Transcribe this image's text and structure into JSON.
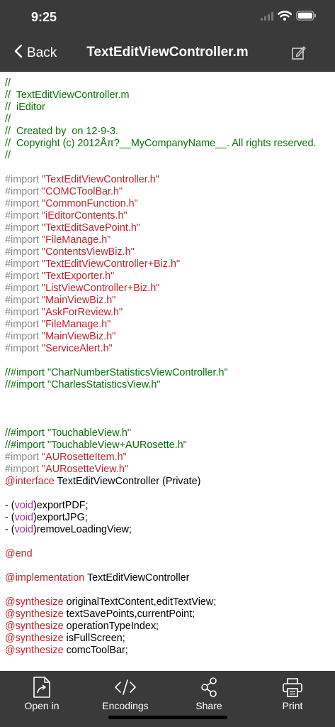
{
  "status": {
    "time": "9:25"
  },
  "nav": {
    "back_label": "Back",
    "title": "TextEditViewController.m"
  },
  "code_lines": [
    [
      [
        "c-comment",
        "//"
      ]
    ],
    [
      [
        "c-comment",
        "//  TextEditViewController.m"
      ]
    ],
    [
      [
        "c-comment",
        "//  iEditor"
      ]
    ],
    [
      [
        "c-comment",
        "//"
      ]
    ],
    [
      [
        "c-comment",
        "//  Created by  on 12-9-3."
      ]
    ],
    [
      [
        "c-comment",
        "//  Copyright (c) 2012Åπ?__MyCompanyName__. All rights reserved."
      ]
    ],
    [
      [
        "c-comment",
        "//"
      ]
    ],
    [],
    [
      [
        "c-pre",
        "#import "
      ],
      [
        "c-str",
        "\"TextEditViewController.h\""
      ]
    ],
    [
      [
        "c-pre",
        "#import "
      ],
      [
        "c-str",
        "\"COMCToolBar.h\""
      ]
    ],
    [
      [
        "c-pre",
        "#import "
      ],
      [
        "c-str",
        "\"CommonFunction.h\""
      ]
    ],
    [
      [
        "c-pre",
        "#import "
      ],
      [
        "c-str",
        "\"iEditorContents.h\""
      ]
    ],
    [
      [
        "c-pre",
        "#import "
      ],
      [
        "c-str",
        "\"TextEditSavePoint.h\""
      ]
    ],
    [
      [
        "c-pre",
        "#import "
      ],
      [
        "c-str",
        "\"FileManage.h\""
      ]
    ],
    [
      [
        "c-pre",
        "#import "
      ],
      [
        "c-str",
        "\"ContentsViewBiz.h\""
      ]
    ],
    [
      [
        "c-pre",
        "#import "
      ],
      [
        "c-str",
        "\"TextEditViewController+Biz.h\""
      ]
    ],
    [
      [
        "c-pre",
        "#import "
      ],
      [
        "c-str",
        "\"TextExporter.h\""
      ]
    ],
    [
      [
        "c-pre",
        "#import "
      ],
      [
        "c-str",
        "\"ListViewController+Biz.h\""
      ]
    ],
    [
      [
        "c-pre",
        "#import "
      ],
      [
        "c-str",
        "\"MainViewBiz.h\""
      ]
    ],
    [
      [
        "c-pre",
        "#import "
      ],
      [
        "c-str",
        "\"AskForReview.h\""
      ]
    ],
    [
      [
        "c-pre",
        "#import "
      ],
      [
        "c-str",
        "\"FileManage.h\""
      ]
    ],
    [
      [
        "c-pre",
        "#import "
      ],
      [
        "c-str",
        "\"MainViewBiz.h\""
      ]
    ],
    [
      [
        "c-pre",
        "#import "
      ],
      [
        "c-str",
        "\"ServiceAlert.h\""
      ]
    ],
    [],
    [
      [
        "c-comment",
        "//#import \"CharNumberStatisticsViewController.h\""
      ]
    ],
    [
      [
        "c-comment",
        "//#import \"CharlesStatisticsView.h\""
      ]
    ],
    [],
    [],
    [],
    [
      [
        "c-comment",
        "//#import \"TouchableView.h\""
      ]
    ],
    [
      [
        "c-comment",
        "//#import \"TouchableView+AURosette.h\""
      ]
    ],
    [
      [
        "c-pre",
        "#import "
      ],
      [
        "c-str",
        "\"AURosetteItem.h\""
      ]
    ],
    [
      [
        "c-pre",
        "#import "
      ],
      [
        "c-str",
        "\"AURosetteView.h\""
      ]
    ],
    [
      [
        "c-kw",
        "@interface"
      ],
      [
        "c-plain",
        " TextEditViewController (Private)"
      ]
    ],
    [],
    [
      [
        "c-plain",
        "- ("
      ],
      [
        "c-type",
        "void"
      ],
      [
        "c-plain",
        ")exportPDF;"
      ]
    ],
    [
      [
        "c-plain",
        "- ("
      ],
      [
        "c-type",
        "void"
      ],
      [
        "c-plain",
        ")exportJPG;"
      ]
    ],
    [
      [
        "c-plain",
        "- ("
      ],
      [
        "c-type",
        "void"
      ],
      [
        "c-plain",
        ")removeLoadingView;"
      ]
    ],
    [],
    [
      [
        "c-kw",
        "@end"
      ]
    ],
    [],
    [
      [
        "c-kw",
        "@implementation"
      ],
      [
        "c-plain",
        " TextEditViewController"
      ]
    ],
    [],
    [
      [
        "c-kw",
        "@synthesize"
      ],
      [
        "c-plain",
        " originalTextContent,editTextView;"
      ]
    ],
    [
      [
        "c-kw",
        "@synthesize"
      ],
      [
        "c-plain",
        " textSavePoints,currentPoint;"
      ]
    ],
    [
      [
        "c-kw",
        "@synthesize"
      ],
      [
        "c-plain",
        " operationTypeIndex;"
      ]
    ],
    [
      [
        "c-kw",
        "@synthesize"
      ],
      [
        "c-plain",
        " isFullScreen;"
      ]
    ],
    [
      [
        "c-kw",
        "@synthesize"
      ],
      [
        "c-plain",
        " comcToolBar;"
      ]
    ]
  ],
  "tabs": {
    "open_in": "Open in",
    "encodings": "Encodings",
    "share": "Share",
    "print": "Print"
  },
  "colors": {
    "bar_background": "#3a3a3a",
    "comment": "#0a6f0a",
    "preprocessor": "#8a8a8a",
    "string": "#c2242c",
    "keyword": "#c2242c",
    "type": "#b0309a"
  },
  "icons": {
    "back": "chevron-left-icon",
    "edit": "compose-icon",
    "open_in": "document-share-icon",
    "encodings": "code-brackets-icon",
    "share": "share-nodes-icon",
    "print": "printer-icon"
  }
}
